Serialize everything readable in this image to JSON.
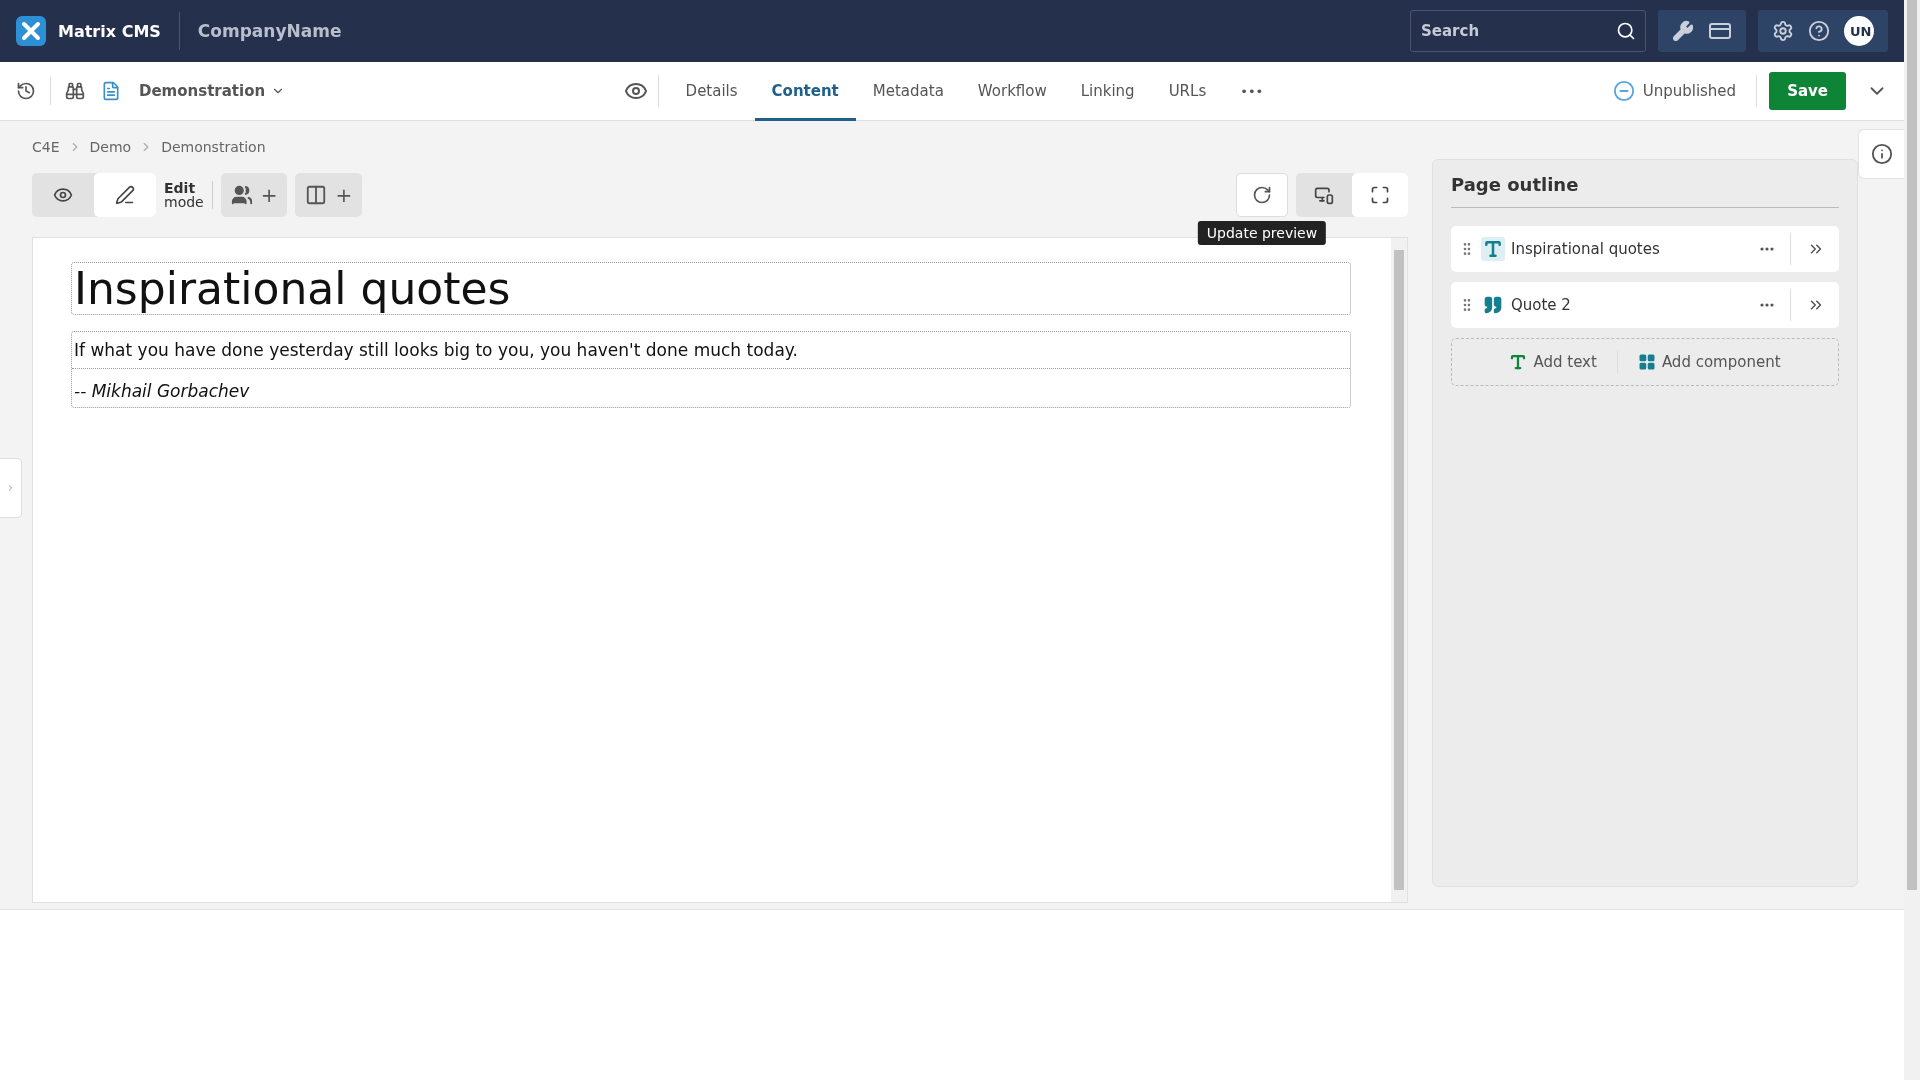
{
  "topbar": {
    "product": "Matrix CMS",
    "company": "CompanyName",
    "search": {
      "placeholder": "Search"
    },
    "avatar": "UN"
  },
  "assetbar": {
    "asset": "Demonstration",
    "tabs": [
      {
        "label": "Details",
        "selected": false
      },
      {
        "label": "Content",
        "selected": true
      },
      {
        "label": "Metadata",
        "selected": false
      },
      {
        "label": "Workflow",
        "selected": false
      },
      {
        "label": "Linking",
        "selected": false
      },
      {
        "label": "URLs",
        "selected": false
      }
    ],
    "more": "•••",
    "status": "Unpublished",
    "save": "Save"
  },
  "breadcrumbs": [
    "C4E",
    "Demo",
    "Demonstration"
  ],
  "toolbar": {
    "modes": [
      {
        "kind": "preview",
        "selected": false
      },
      {
        "kind": "edit",
        "selected": true
      }
    ],
    "mode_label": {
      "bold": "Edit",
      "rest": "mode"
    },
    "add_users": "+",
    "add_layout": "+",
    "views": [
      {
        "kind": "responsive",
        "selected": true
      },
      {
        "kind": "fullscreen",
        "selected": false
      }
    ],
    "tooltip": "Update preview"
  },
  "preview": {
    "heading": "Inspirational quotes",
    "quote": "If what you have done yesterday still looks big to you, you haven't done much today.",
    "author": "-- Mikhail Gorbachev"
  },
  "outline": {
    "title": "Page outline",
    "items": [
      {
        "kind": "text",
        "label": "Inspirational quotes",
        "selected": true
      },
      {
        "kind": "quote",
        "label": "Quote 2",
        "selected": false
      }
    ],
    "add_text": "Add text",
    "add_component": "Add component"
  }
}
